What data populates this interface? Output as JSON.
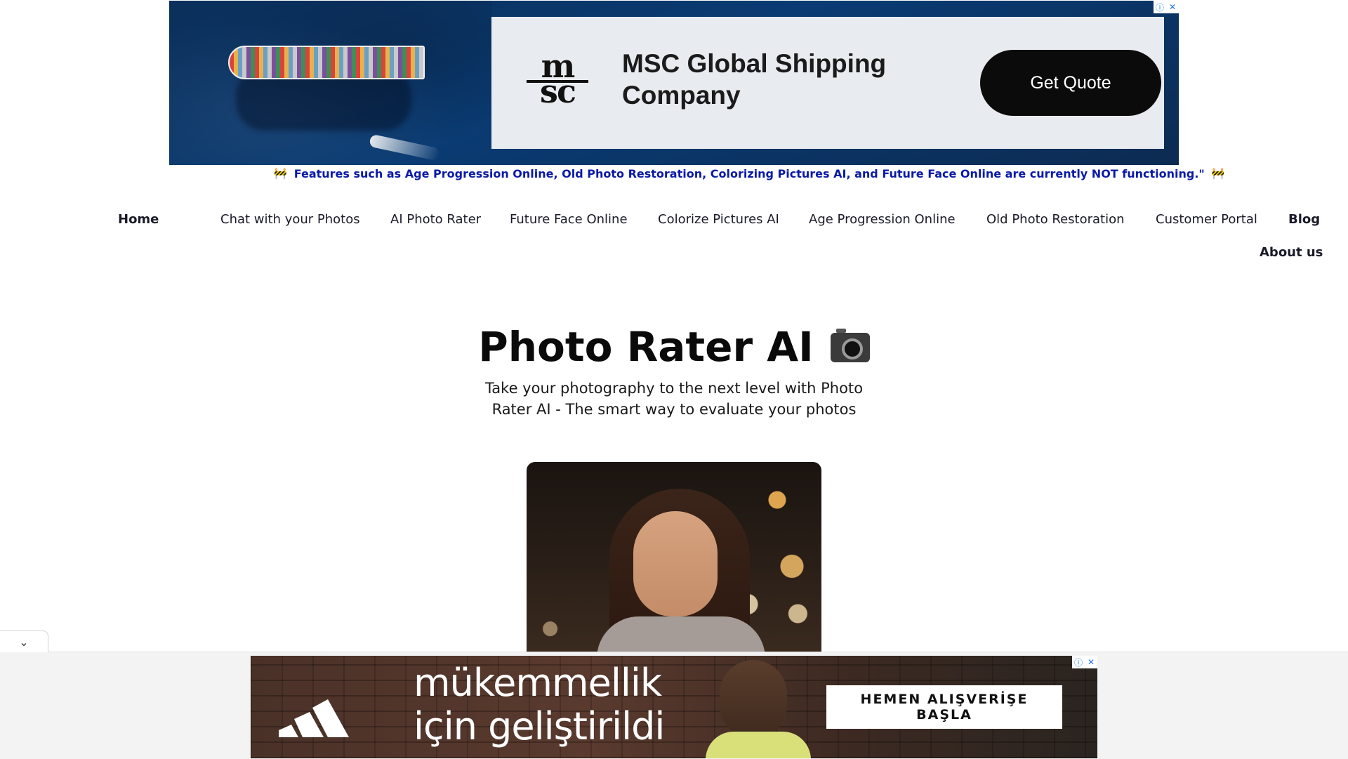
{
  "top_ad": {
    "logo_line1": "m",
    "logo_line2": "sc",
    "headline": "MSC Global Shipping Company",
    "cta": "Get Quote",
    "info_icon": "info-icon",
    "close_icon": "close-icon",
    "info_glyph": "ⓘ",
    "close_glyph": "✕"
  },
  "notice": {
    "barrier_glyph": "🚧",
    "text": "Features such as Age Progression Online, Old Photo Restoration, Colorizing Pictures AI, and Future Face Online are currently NOT functioning.\""
  },
  "nav": {
    "items": [
      {
        "label": "Home"
      },
      {
        "label": "Chat with your Photos"
      },
      {
        "label": "AI Photo Rater"
      },
      {
        "label": "Future Face Online"
      },
      {
        "label": "Colorize Pictures AI"
      },
      {
        "label": "Age Progression Online"
      },
      {
        "label": "Old Photo Restoration"
      },
      {
        "label": "Customer Portal"
      },
      {
        "label": "Blog"
      },
      {
        "label": "About us"
      }
    ]
  },
  "hero": {
    "title": "Photo Rater AI",
    "subtitle": "Take your photography to the next level with Photo Rater AI - The smart way to evaluate your photos",
    "icon": "camera-icon"
  },
  "collapse": {
    "glyph": "⌄"
  },
  "bottom_ad": {
    "headline": "mükemmellik için geliştirildi",
    "cta": "HEMEN ALIŞVERİŞE BAŞLA",
    "info_glyph": "ⓘ",
    "close_glyph": "✕"
  },
  "colors": {
    "notice_text": "#0a1aa8",
    "ad_background": "#0a3b73",
    "cta_dark": "#0b0b0b"
  }
}
